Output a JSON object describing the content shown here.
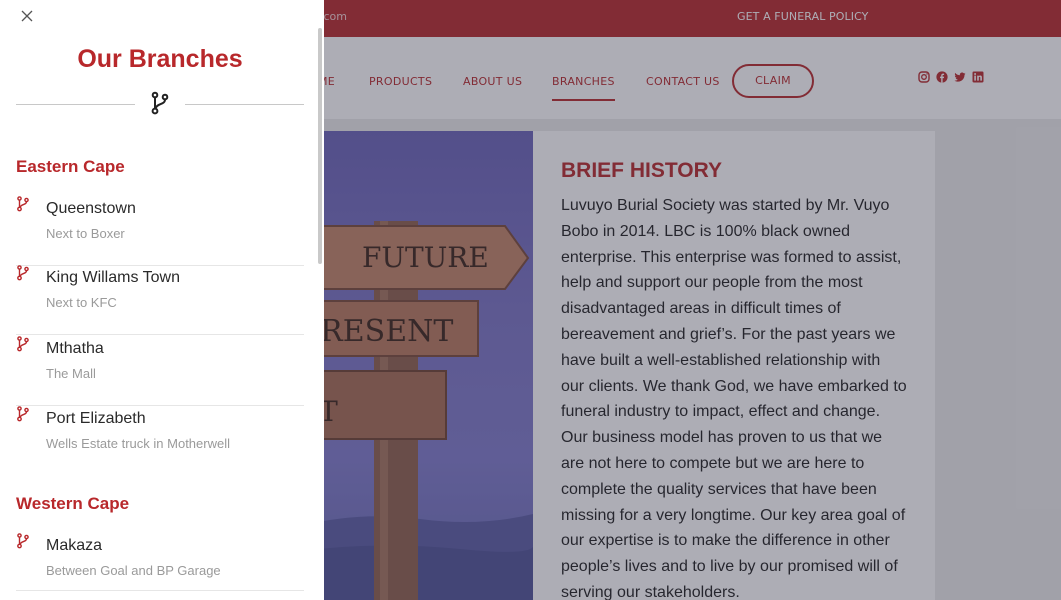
{
  "topbar": {
    "email_fragment": ".com",
    "cta": "GET A FUNERAL POLICY"
  },
  "nav": {
    "items": [
      "ME",
      "PRODUCTS",
      "ABOUT US",
      "BRANCHES",
      "CONTACT US"
    ],
    "active": "BRANCHES",
    "claim": "CLAIM",
    "socials": [
      "instagram-icon",
      "facebook-icon",
      "twitter-icon",
      "linkedin-icon"
    ]
  },
  "hero": {
    "signs": [
      "FUTURE",
      "PRESENT",
      "ST"
    ]
  },
  "history": {
    "title": "BRIEF HISTORY",
    "body": "Luvuyo Burial Society was started by Mr. Vuyo Bobo in 2014. LBC is 100% black owned enterprise. This enterprise was formed to assist, help and support our people from the most disadvantaged areas in difficult times of bereavement and grief’s. For the past years we have built a well-established relationship with our clients. We thank God, we have embarked to funeral industry to impact, effect and change. Our business model has proven to us that we are not here to compete but we are here to complete the quality services that have been missing for a very longtime. Our key area goal of our expertise is to make the difference in other people’s lives and to live by our promised will of serving our stakeholders."
  },
  "drawer": {
    "title": "Our Branches",
    "close_icon": "close-icon",
    "regions": [
      {
        "name": "Eastern Cape",
        "branches": [
          {
            "name": "Queenstown",
            "location": "Next to Boxer"
          },
          {
            "name": "King Willams Town",
            "location": "Next to KFC"
          },
          {
            "name": "Mthatha",
            "location": "The Mall"
          },
          {
            "name": "Port Elizabeth",
            "location": "Wells Estate truck in Motherwell"
          }
        ]
      },
      {
        "name": "Western Cape",
        "branches": [
          {
            "name": "Makaza",
            "location": "Between Goal and BP Garage"
          }
        ]
      }
    ]
  },
  "colors": {
    "brand": "#b8282b",
    "text": "#2a2a2a",
    "muted": "#9a9a9a"
  }
}
